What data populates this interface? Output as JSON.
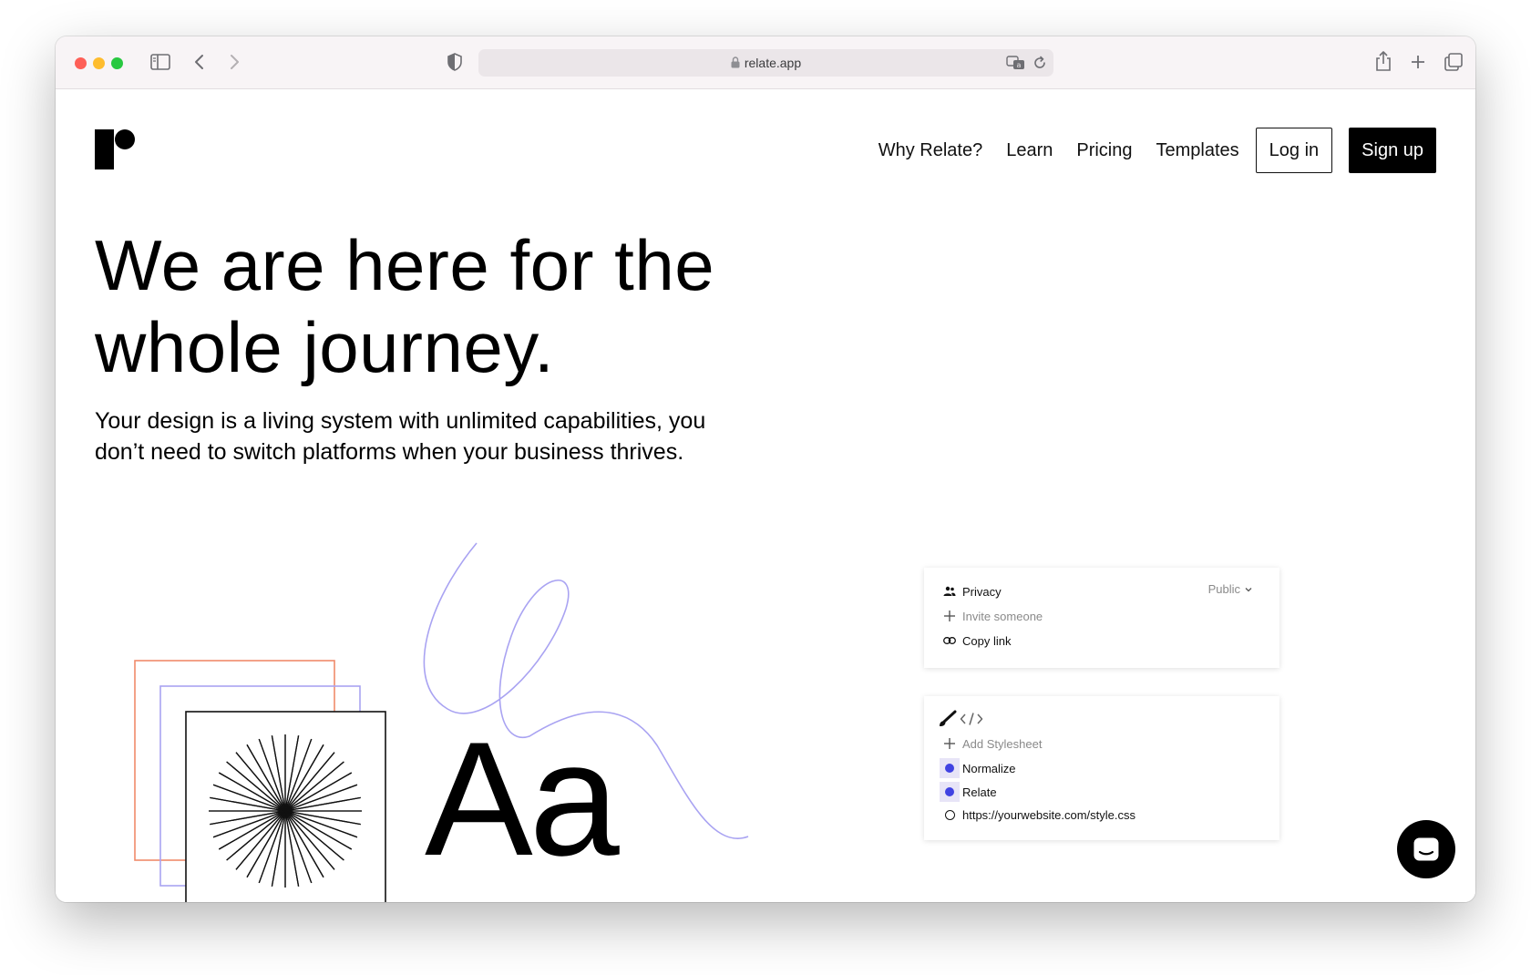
{
  "browser": {
    "url": "relate.app",
    "icons": [
      "close-icon",
      "minimize-icon",
      "zoom-icon",
      "sidebar-icon",
      "back-icon",
      "forward-icon",
      "shield-icon",
      "lock-icon",
      "translate-icon",
      "reload-icon",
      "share-icon",
      "new-tab-icon",
      "tabs-overview-icon"
    ]
  },
  "nav": {
    "links": [
      "Why Relate?",
      "Learn",
      "Pricing",
      "Templates"
    ],
    "login_label": "Log in",
    "signup_label": "Sign up"
  },
  "hero": {
    "headline_line1": "We are here for the",
    "headline_line2": "whole journey.",
    "subhead": "Your design is a living system with unlimited capabilities, you don’t need to switch platforms when your business thrives."
  },
  "illustration": {
    "glyph": "Aa",
    "colors": {
      "orange": "#f08a6b",
      "purple": "#a9a3f2",
      "black": "#111111"
    }
  },
  "privacy_card": {
    "privacy_label": "Privacy",
    "visibility": "Public",
    "invite_label": "Invite someone",
    "copy_link_label": "Copy link"
  },
  "stylesheet_card": {
    "add_label": "Add Stylesheet",
    "sheets": [
      "Normalize",
      "Relate",
      "https://yourwebsite.com/style.css"
    ],
    "accent": "#4042e2"
  }
}
